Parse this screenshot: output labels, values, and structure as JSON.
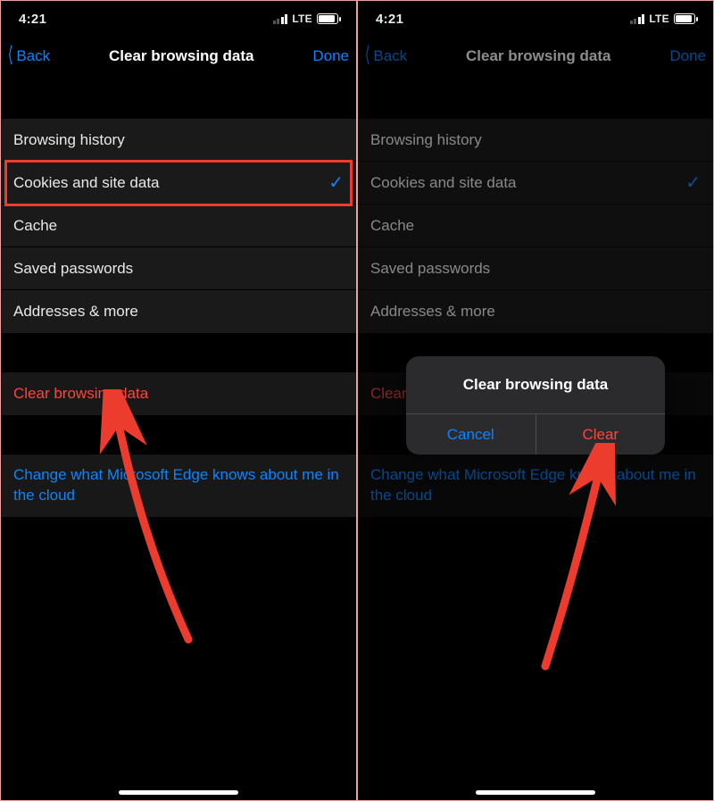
{
  "status": {
    "time": "4:21",
    "network": "LTE"
  },
  "nav": {
    "back": "Back",
    "title": "Clear browsing data",
    "done": "Done"
  },
  "items": [
    {
      "label": "Browsing history",
      "checked": false
    },
    {
      "label": "Cookies and site data",
      "checked": true
    },
    {
      "label": "Cache",
      "checked": false
    },
    {
      "label": "Saved passwords",
      "checked": false
    },
    {
      "label": "Addresses & more",
      "checked": false
    }
  ],
  "clear_action": "Clear browsing data",
  "cloud_link": "Change what Microsoft Edge knows about me in the cloud",
  "alert": {
    "title": "Clear browsing data",
    "cancel": "Cancel",
    "clear": "Clear"
  }
}
